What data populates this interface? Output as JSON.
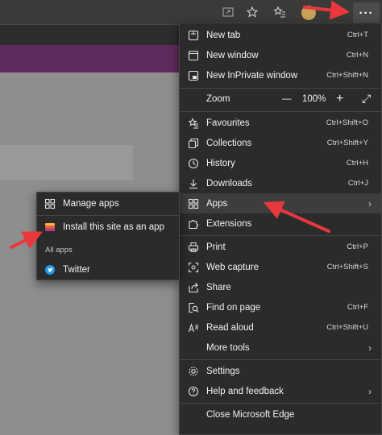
{
  "menu": {
    "items": [
      {
        "label": "New tab",
        "shortcut": "Ctrl+T"
      },
      {
        "label": "New window",
        "shortcut": "Ctrl+N"
      },
      {
        "label": "New InPrivate window",
        "shortcut": "Ctrl+Shift+N"
      },
      {
        "label": "Zoom"
      },
      {
        "label": "Favourites",
        "shortcut": "Ctrl+Shift+O"
      },
      {
        "label": "Collections",
        "shortcut": "Ctrl+Shift+Y"
      },
      {
        "label": "History",
        "shortcut": "Ctrl+H"
      },
      {
        "label": "Downloads",
        "shortcut": "Ctrl+J"
      },
      {
        "label": "Apps"
      },
      {
        "label": "Extensions"
      },
      {
        "label": "Print",
        "shortcut": "Ctrl+P"
      },
      {
        "label": "Web capture",
        "shortcut": "Ctrl+Shift+S"
      },
      {
        "label": "Share"
      },
      {
        "label": "Find on page",
        "shortcut": "Ctrl+F"
      },
      {
        "label": "Read aloud",
        "shortcut": "Ctrl+Shift+U"
      },
      {
        "label": "More tools"
      },
      {
        "label": "Settings"
      },
      {
        "label": "Help and feedback"
      },
      {
        "label": "Close Microsoft Edge"
      }
    ],
    "zoom": {
      "minus": "—",
      "value": "100%",
      "plus": "+",
      "fullscreen": "⤢"
    }
  },
  "submenu": {
    "manage": "Manage apps",
    "install": "Install this site as an app",
    "all_apps_heading": "All apps",
    "twitter": "Twitter"
  },
  "toolbar": {
    "more": "···"
  },
  "colors": {
    "accent_arrow": "#e8383d",
    "menu_bg": "#2b2b2b",
    "purple_bar": "#5e2b5c"
  }
}
